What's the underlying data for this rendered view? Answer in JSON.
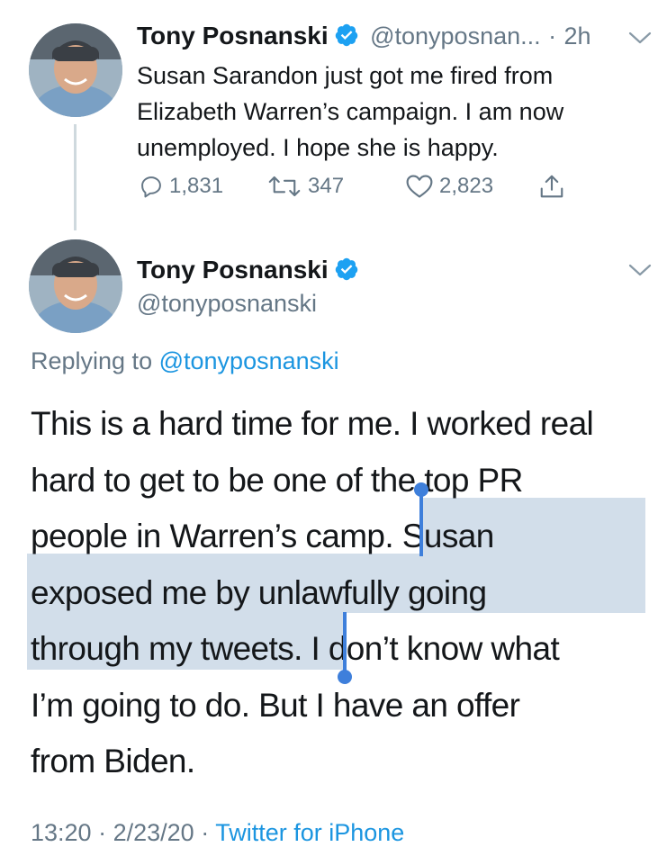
{
  "tweet1": {
    "name": "Tony Posnanski",
    "handle": "@tonyposnan...",
    "sep": "·",
    "time": "2h",
    "lines": [
      "Susan Sarandon just got me fired from",
      "Elizabeth Warren’s campaign. I am now",
      "unemployed. I hope she is happy."
    ],
    "replies": "1,831",
    "retweets": "347",
    "likes": "2,823"
  },
  "tweet2": {
    "name": "Tony Posnanski",
    "handle": "@tonyposnanski",
    "replying_prefix": "Replying to",
    "replying_handle": "@tonyposnanski",
    "lines": [
      "This is a hard time for me. I worked real",
      "hard to get to be one of the top PR",
      "people in Warren’s camp. Susan",
      "exposed me by unlawfully going",
      "through my tweets. I don’t know what",
      "I’m going to do. But I have an offer",
      "from Biden."
    ],
    "time": "13:20",
    "date": "2/23/20",
    "source": "Twitter for iPhone"
  },
  "colors": {
    "link": "#1b95e0",
    "verified": "#1da1f2",
    "selection": "#d2deea",
    "caret": "#3e7fdb",
    "muted": "#657786"
  }
}
